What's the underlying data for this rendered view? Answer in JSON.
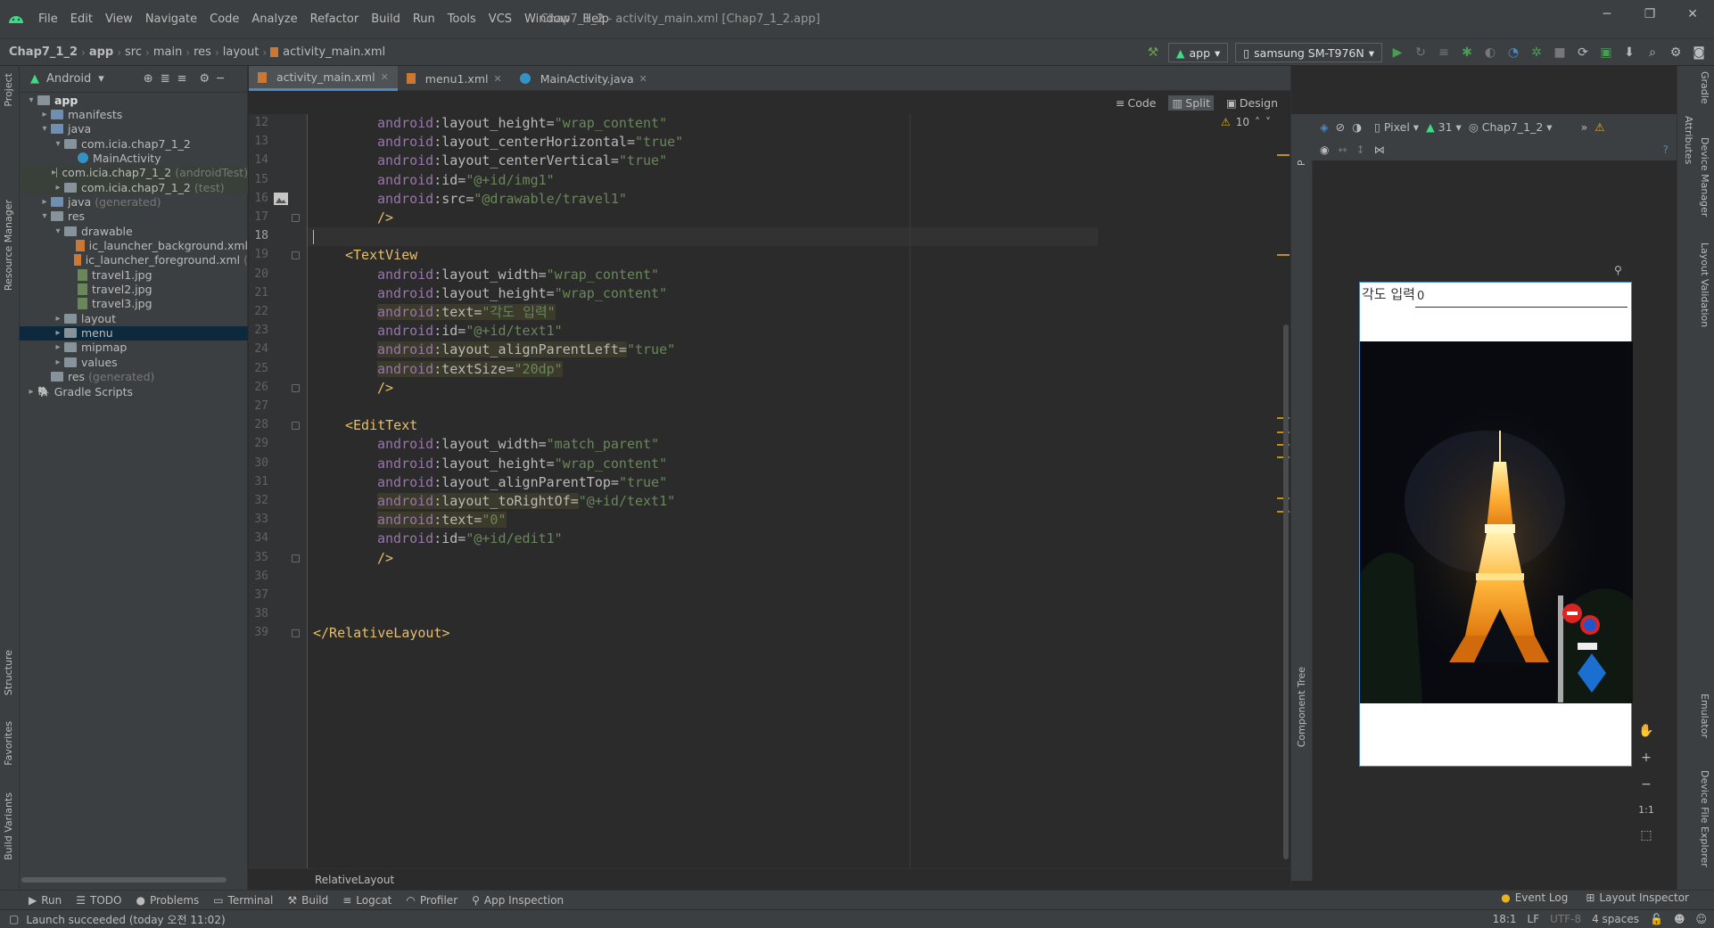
{
  "menubar": {
    "items": [
      "File",
      "Edit",
      "View",
      "Navigate",
      "Code",
      "Analyze",
      "Refactor",
      "Build",
      "Run",
      "Tools",
      "VCS",
      "Window",
      "Help"
    ],
    "window_title": "Chap7_1_2 - activity_main.xml [Chap7_1_2.app]"
  },
  "navbar": {
    "crumbs": [
      "Chap7_1_2",
      "app",
      "src",
      "main",
      "res",
      "layout",
      "activity_main.xml"
    ],
    "run_config": "app",
    "device": "samsung SM-T976N"
  },
  "project": {
    "view_mode": "Android",
    "tree": [
      {
        "label": "app",
        "indent": 0,
        "arrow": "▾",
        "icon": "folder",
        "bold": true
      },
      {
        "label": "manifests",
        "indent": 1,
        "arrow": "▸",
        "icon": "folder-blue"
      },
      {
        "label": "java",
        "indent": 1,
        "arrow": "▾",
        "icon": "folder-blue"
      },
      {
        "label": "com.icia.chap7_1_2",
        "indent": 2,
        "arrow": "▾",
        "icon": "folder"
      },
      {
        "label": "MainActivity",
        "indent": 3,
        "arrow": "",
        "icon": "java"
      },
      {
        "label": "com.icia.chap7_1_2",
        "suffix": "(androidTest)",
        "indent": 2,
        "arrow": "▸",
        "icon": "folder",
        "hl": true
      },
      {
        "label": "com.icia.chap7_1_2",
        "suffix": "(test)",
        "indent": 2,
        "arrow": "▸",
        "icon": "folder",
        "hl": true
      },
      {
        "label": "java",
        "suffix": "(generated)",
        "indent": 1,
        "arrow": "▸",
        "icon": "folder-blue"
      },
      {
        "label": "res",
        "indent": 1,
        "arrow": "▾",
        "icon": "folder"
      },
      {
        "label": "drawable",
        "indent": 2,
        "arrow": "▾",
        "icon": "folder"
      },
      {
        "label": "ic_launcher_background.xml",
        "indent": 3,
        "arrow": "",
        "icon": "xml"
      },
      {
        "label": "ic_launcher_foreground.xml",
        "suffix": "(",
        "indent": 3,
        "arrow": "",
        "icon": "xml"
      },
      {
        "label": "travel1.jpg",
        "indent": 3,
        "arrow": "",
        "icon": "img"
      },
      {
        "label": "travel2.jpg",
        "indent": 3,
        "arrow": "",
        "icon": "img"
      },
      {
        "label": "travel3.jpg",
        "indent": 3,
        "arrow": "",
        "icon": "img"
      },
      {
        "label": "layout",
        "indent": 2,
        "arrow": "▸",
        "icon": "folder"
      },
      {
        "label": "menu",
        "indent": 2,
        "arrow": "▸",
        "icon": "folder",
        "sel": true
      },
      {
        "label": "mipmap",
        "indent": 2,
        "arrow": "▸",
        "icon": "folder"
      },
      {
        "label": "values",
        "indent": 2,
        "arrow": "▸",
        "icon": "folder"
      },
      {
        "label": "res",
        "suffix": "(generated)",
        "indent": 1,
        "arrow": "",
        "icon": "folder"
      },
      {
        "label": "Gradle Scripts",
        "indent": 0,
        "arrow": "▸",
        "icon": "gradle"
      }
    ]
  },
  "left_tabs": [
    "Project",
    "Resource Manager",
    "Structure",
    "Favorites",
    "Build Variants"
  ],
  "editor": {
    "tabs": [
      {
        "label": "activity_main.xml",
        "active": true,
        "icon": "xml"
      },
      {
        "label": "menu1.xml",
        "active": false,
        "icon": "xml"
      },
      {
        "label": "MainActivity.java",
        "active": false,
        "icon": "java"
      }
    ],
    "modes": [
      "Code",
      "Split",
      "Design"
    ],
    "active_mode": "Split",
    "warnings": "10",
    "lines": [
      {
        "n": 12,
        "indent": 8,
        "parts": [
          [
            "ns",
            "android"
          ],
          [
            "at",
            ":layout_height="
          ],
          [
            "st",
            "\"wrap_content\""
          ]
        ]
      },
      {
        "n": 13,
        "indent": 8,
        "parts": [
          [
            "ns",
            "android"
          ],
          [
            "at",
            ":layout_centerHorizontal="
          ],
          [
            "st",
            "\"true\""
          ]
        ]
      },
      {
        "n": 14,
        "indent": 8,
        "parts": [
          [
            "ns",
            "android"
          ],
          [
            "at",
            ":layout_centerVertical="
          ],
          [
            "st",
            "\"true\""
          ]
        ]
      },
      {
        "n": 15,
        "indent": 8,
        "parts": [
          [
            "ns",
            "android"
          ],
          [
            "at",
            ":id="
          ],
          [
            "st",
            "\"@+id/img1\""
          ]
        ]
      },
      {
        "n": 16,
        "indent": 8,
        "parts": [
          [
            "ns",
            "android"
          ],
          [
            "at",
            ":src="
          ],
          [
            "st",
            "\"@drawable/travel1\""
          ]
        ]
      },
      {
        "n": 17,
        "indent": 8,
        "parts": [
          [
            "tg",
            "/>"
          ]
        ]
      },
      {
        "n": 18,
        "indent": 0,
        "parts": [],
        "cur": true
      },
      {
        "n": 19,
        "indent": 4,
        "parts": [
          [
            "tg",
            "<TextView"
          ]
        ]
      },
      {
        "n": 20,
        "indent": 8,
        "parts": [
          [
            "ns",
            "android"
          ],
          [
            "at",
            ":layout_width="
          ],
          [
            "st",
            "\"wrap_content\""
          ]
        ]
      },
      {
        "n": 21,
        "indent": 8,
        "parts": [
          [
            "ns",
            "android"
          ],
          [
            "at",
            ":layout_height="
          ],
          [
            "st",
            "\"wrap_content\""
          ]
        ]
      },
      {
        "n": 22,
        "indent": 8,
        "hl": true,
        "parts": [
          [
            "ns",
            "android"
          ],
          [
            "at",
            ":text="
          ],
          [
            "st",
            "\"각도 입력\""
          ]
        ]
      },
      {
        "n": 23,
        "indent": 8,
        "parts": [
          [
            "ns",
            "android"
          ],
          [
            "at",
            ":id="
          ],
          [
            "st",
            "\"@+id/text1\""
          ]
        ]
      },
      {
        "n": 24,
        "indent": 8,
        "hl": true,
        "parts": [
          [
            "ns",
            "android"
          ],
          [
            "at",
            ":layout_alignParentLeft="
          ],
          [
            "st",
            "\"true\""
          ]
        ]
      },
      {
        "n": 25,
        "indent": 8,
        "hl": true,
        "parts": [
          [
            "ns",
            "android"
          ],
          [
            "at",
            ":textSize="
          ],
          [
            "st",
            "\"20dp\""
          ]
        ]
      },
      {
        "n": 26,
        "indent": 8,
        "parts": [
          [
            "tg",
            "/>"
          ]
        ]
      },
      {
        "n": 27,
        "indent": 0,
        "parts": []
      },
      {
        "n": 28,
        "indent": 4,
        "parts": [
          [
            "tg",
            "<EditText"
          ]
        ]
      },
      {
        "n": 29,
        "indent": 8,
        "parts": [
          [
            "ns",
            "android"
          ],
          [
            "at",
            ":layout_width="
          ],
          [
            "st",
            "\"match_parent\""
          ]
        ]
      },
      {
        "n": 30,
        "indent": 8,
        "parts": [
          [
            "ns",
            "android"
          ],
          [
            "at",
            ":layout_height="
          ],
          [
            "st",
            "\"wrap_content\""
          ]
        ]
      },
      {
        "n": 31,
        "indent": 8,
        "parts": [
          [
            "ns",
            "android"
          ],
          [
            "at",
            ":layout_alignParentTop="
          ],
          [
            "st",
            "\"true\""
          ]
        ]
      },
      {
        "n": 32,
        "indent": 8,
        "hl": true,
        "parts": [
          [
            "ns",
            "android"
          ],
          [
            "at",
            ":layout_toRightOf="
          ],
          [
            "st",
            "\"@+id/text1\""
          ]
        ]
      },
      {
        "n": 33,
        "indent": 8,
        "hl": true,
        "parts": [
          [
            "ns",
            "android"
          ],
          [
            "at",
            ":text="
          ],
          [
            "st",
            "\"0\""
          ]
        ]
      },
      {
        "n": 34,
        "indent": 8,
        "parts": [
          [
            "ns",
            "android"
          ],
          [
            "at",
            ":id="
          ],
          [
            "st",
            "\"@+id/edit1\""
          ]
        ]
      },
      {
        "n": 35,
        "indent": 8,
        "parts": [
          [
            "tg",
            "/>"
          ]
        ]
      },
      {
        "n": 36,
        "indent": 0,
        "parts": []
      },
      {
        "n": 37,
        "indent": 0,
        "parts": []
      },
      {
        "n": 38,
        "indent": 0,
        "parts": []
      },
      {
        "n": 39,
        "indent": 0,
        "parts": [
          [
            "tg",
            "</RelativeLayout>"
          ]
        ]
      }
    ],
    "bottom_breadcrumb": "RelativeLayout"
  },
  "design": {
    "device": "Pixel",
    "api": "31",
    "theme": "Chap7_1_2",
    "preview_label": "각도 입력",
    "preview_edit": "0",
    "zoom_fit": "1:1"
  },
  "side_labels": {
    "palette": "Palette",
    "component_tree": "Component Tree"
  },
  "right_tabs": [
    "Gradle",
    "Attributes",
    "Device Manager",
    "Layout Validation",
    "Emulator",
    "Device File Explorer"
  ],
  "bottom_tools": [
    "Run",
    "TODO",
    "Problems",
    "Terminal",
    "Build",
    "Logcat",
    "Profiler",
    "App Inspection"
  ],
  "bottom_right": [
    "Event Log",
    "Layout Inspector"
  ],
  "status": {
    "message": "Launch succeeded (today 오전 11:02)",
    "position": "18:1",
    "line_sep": "LF",
    "encoding": "UTF-8",
    "indent": "4 spaces"
  }
}
